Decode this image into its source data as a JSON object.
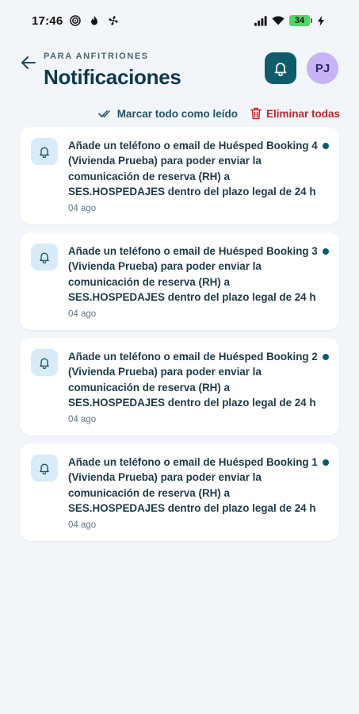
{
  "status_bar": {
    "time": "17:46",
    "battery": "34",
    "icons": [
      "target-icon",
      "flame-icon",
      "fan-icon",
      "signal-icon",
      "wifi-icon",
      "battery-icon",
      "charging-icon"
    ]
  },
  "header": {
    "eyebrow": "PARA ANFITRIONES",
    "title": "Notificaciones",
    "avatar_initials": "PJ"
  },
  "actions": {
    "mark_all_read": "Marcar todo como leído",
    "delete_all": "Eliminar todas"
  },
  "notifications": [
    {
      "text": "Añade un teléfono o email de Huésped Booking 4 (Vivienda Prueba) para poder enviar la comunicación de reserva (RH) a SES.HOSPEDAJES dentro del plazo legal de 24 h",
      "time": "04 ago",
      "unread": true
    },
    {
      "text": "Añade un teléfono o email de Huésped Booking 3 (Vivienda Prueba) para poder enviar la comunicación de reserva (RH) a SES.HOSPEDAJES dentro del plazo legal de 24 h",
      "time": "04 ago",
      "unread": true
    },
    {
      "text": "Añade un teléfono o email de Huésped Booking 2 (Vivienda Prueba) para poder enviar la comunicación de reserva (RH) a SES.HOSPEDAJES dentro del plazo legal de 24 h",
      "time": "04 ago",
      "unread": true
    },
    {
      "text": "Añade un teléfono o email de Huésped Booking 1 (Vivienda Prueba) para poder enviar la comunicación de reserva (RH) a SES.HOSPEDAJES dentro del plazo legal de 24 h",
      "time": "04 ago",
      "unread": true
    }
  ],
  "colors": {
    "background": "#f2f5f9",
    "primary": "#0f5b6e",
    "title": "#0c3a4b",
    "danger": "#c0262d",
    "avatar_bg": "#c6b4f6",
    "icon_bg": "#d7ecf8"
  }
}
